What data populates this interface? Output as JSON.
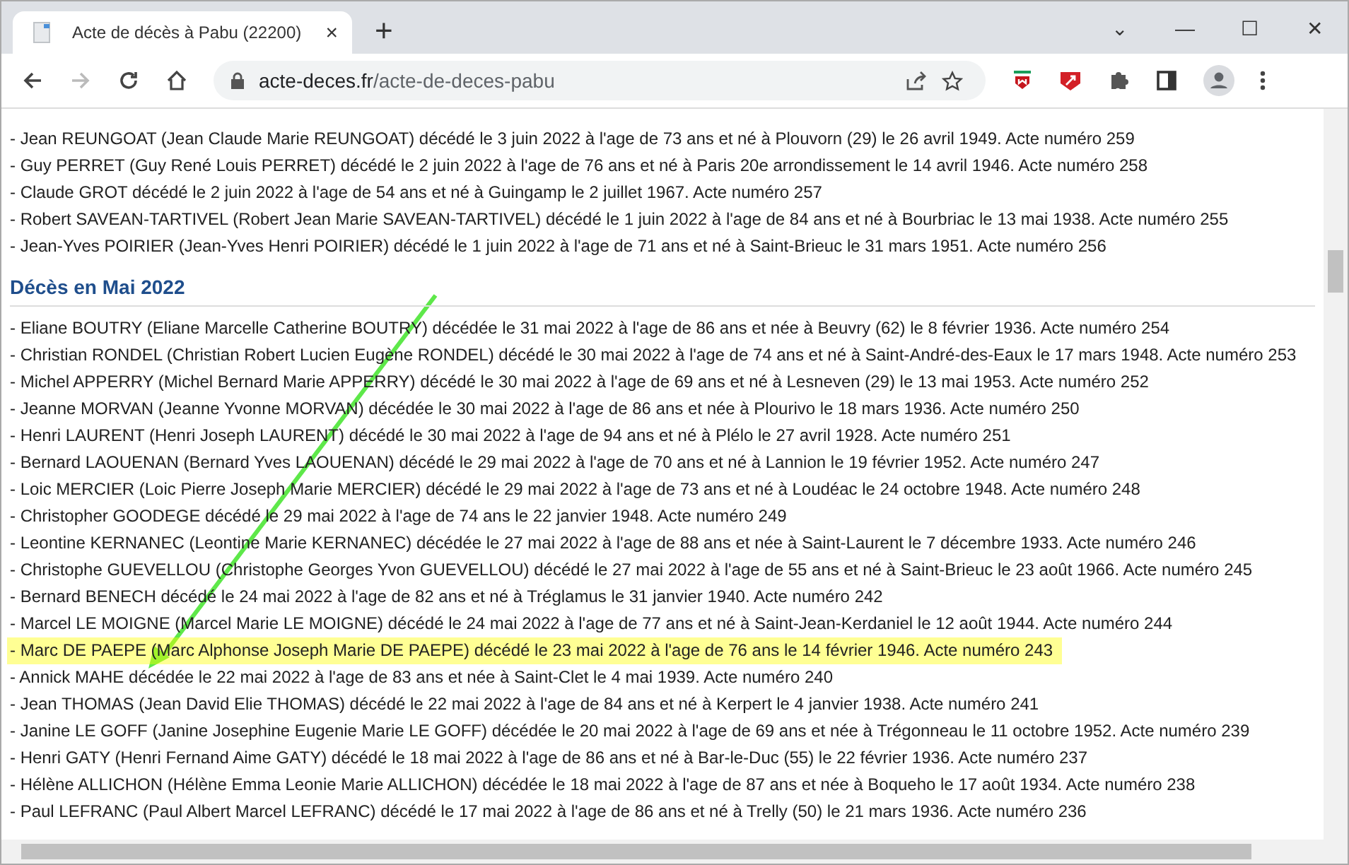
{
  "tab": {
    "title": "Acte de décès à Pabu (22200)",
    "close": "×",
    "new_tab": "+"
  },
  "window_controls": {
    "collapse": "⌄",
    "minimize": "—",
    "maximize": "☐",
    "close": "✕"
  },
  "address_bar": {
    "domain": "acte-deces.fr",
    "path": "/acte-de-deces-pabu"
  },
  "before_entries": [
    {
      "text": "- Jean REUNGOAT (Jean Claude Marie REUNGOAT) décédé le 3 juin 2022 à l'age de 73 ans et né à Plouvorn (29) le 26 avril 1949. Acte numéro 259",
      "highlighted": false
    },
    {
      "text": "- Guy PERRET (Guy René Louis PERRET) décédé le 2 juin 2022 à l'age de 76 ans et né à Paris 20e arrondissement le 14 avril 1946. Acte numéro 258",
      "highlighted": false
    },
    {
      "text": "- Claude GROT décédé le 2 juin 2022 à l'age de 54 ans et né à Guingamp le 2 juillet 1967. Acte numéro 257",
      "highlighted": false
    },
    {
      "text": "- Robert SAVEAN-TARTIVEL (Robert Jean Marie SAVEAN-TARTIVEL) décédé le 1 juin 2022 à l'age de 84 ans et né à Bourbriac le 13 mai 1938. Acte numéro 255",
      "highlighted": false
    },
    {
      "text": "- Jean-Yves POIRIER (Jean-Yves Henri POIRIER) décédé le 1 juin 2022 à l'age de 71 ans et né à Saint-Brieuc le 31 mars 1951. Acte numéro 256",
      "highlighted": false
    }
  ],
  "section_heading": "Décès en Mai 2022",
  "entries": [
    {
      "text": "- Eliane BOUTRY (Eliane Marcelle Catherine BOUTRY) décédée le 31 mai 2022 à l'age de 86 ans et née à Beuvry (62) le 8 février 1936. Acte numéro 254",
      "highlighted": false
    },
    {
      "text": "- Christian RONDEL (Christian Robert Lucien Eugène RONDEL) décédé le 30 mai 2022 à l'age de 74 ans et né à Saint-André-des-Eaux le 17 mars 1948. Acte numéro 253",
      "highlighted": false
    },
    {
      "text": "- Michel APPERRY (Michel Bernard Marie APPERRY) décédé le 30 mai 2022 à l'age de 69 ans et né à Lesneven (29) le 13 mai 1953. Acte numéro 252",
      "highlighted": false
    },
    {
      "text": "- Jeanne MORVAN (Jeanne Yvonne MORVAN) décédée le 30 mai 2022 à l'age de 86 ans et née à Plourivo le 18 mars 1936. Acte numéro 250",
      "highlighted": false
    },
    {
      "text": "- Henri LAURENT (Henri Joseph LAURENT) décédé le 30 mai 2022 à l'age de 94 ans et né à Plélo le 27 avril 1928. Acte numéro 251",
      "highlighted": false
    },
    {
      "text": "- Bernard LAOUENAN (Bernard Yves LAOUENAN) décédé le 29 mai 2022 à l'age de 70 ans et né à Lannion le 19 février 1952. Acte numéro 247",
      "highlighted": false
    },
    {
      "text": "- Loic MERCIER (Loic Pierre Joseph Marie MERCIER) décédé le 29 mai 2022 à l'age de 73 ans et né à Loudéac le 24 octobre 1948. Acte numéro 248",
      "highlighted": false
    },
    {
      "text": "- Christopher GOODEGE décédé le 29 mai 2022 à l'age de 74 ans le 22 janvier 1948. Acte numéro 249",
      "highlighted": false
    },
    {
      "text": "- Leontine KERNANEC (Leontine Marie KERNANEC) décédée le 27 mai 2022 à l'age de 88 ans et née à Saint-Laurent le 7 décembre 1933. Acte numéro 246",
      "highlighted": false
    },
    {
      "text": "- Christophe GUEVELLOU (Christophe Georges Yvon GUEVELLOU) décédé le 27 mai 2022 à l'age de 55 ans et né à Saint-Brieuc le 23 août 1966. Acte numéro 245",
      "highlighted": false
    },
    {
      "text": "- Bernard BENECH décédé le 24 mai 2022 à l'age de 82 ans et né à Tréglamus le 31 janvier 1940. Acte numéro 242",
      "highlighted": false
    },
    {
      "text": "- Marcel LE MOIGNE (Marcel Marie LE MOIGNE) décédé le 24 mai 2022 à l'age de 77 ans et né à Saint-Jean-Kerdaniel le 12 août 1944. Acte numéro 244",
      "highlighted": false
    },
    {
      "text": "- Marc DE PAEPE (Marc Alphonse Joseph Marie DE PAEPE) décédé le 23 mai 2022 à l'age de 76 ans le 14 février 1946. Acte numéro 243",
      "highlighted": true
    },
    {
      "text": "- Annick MAHE décédée le 22 mai 2022 à l'age de 83 ans et née à Saint-Clet le 4 mai 1939. Acte numéro 240",
      "highlighted": false
    },
    {
      "text": "- Jean THOMAS (Jean David Elie THOMAS) décédé le 22 mai 2022 à l'age de 84 ans et né à Kerpert le 4 janvier 1938. Acte numéro 241",
      "highlighted": false
    },
    {
      "text": "- Janine LE GOFF (Janine Josephine Eugenie Marie LE GOFF) décédée le 20 mai 2022 à l'age de 69 ans et née à Trégonneau le 11 octobre 1952. Acte numéro 239",
      "highlighted": false
    },
    {
      "text": "- Henri GATY (Henri Fernand Aime GATY) décédé le 18 mai 2022 à l'age de 86 ans et né à Bar-le-Duc (55) le 22 février 1936. Acte numéro 237",
      "highlighted": false
    },
    {
      "text": "- Hélène ALLICHON (Hélène Emma Leonie Marie ALLICHON) décédée le 18 mai 2022 à l'age de 87 ans et née à Boqueho le 17 août 1934. Acte numéro 238",
      "highlighted": false
    },
    {
      "text": "- Paul LEFRANC (Paul Albert Marcel LEFRANC) décédé le 17 mai 2022 à l'age de 86 ans et né à Trelly (50) le 21 mars 1936. Acte numéro 236",
      "highlighted": false
    }
  ]
}
